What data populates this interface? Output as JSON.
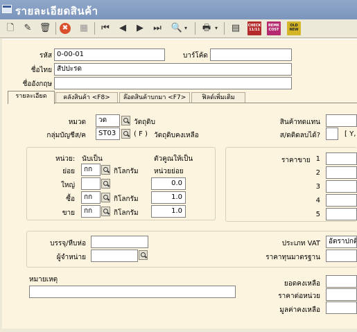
{
  "window": {
    "title": "รายละเอียดสินค้า"
  },
  "toolbar": {
    "buttons": [
      {
        "name": "new-icon",
        "glyph": "🗋"
      },
      {
        "name": "edit-icon",
        "glyph": "✎"
      },
      {
        "name": "delete-icon",
        "glyph": "🗑"
      },
      {
        "name": "cancel-icon",
        "glyph": "✖"
      },
      {
        "name": "save-icon",
        "glyph": "▦"
      },
      {
        "name": "first-record-icon",
        "glyph": "⏮"
      },
      {
        "name": "previous-record-icon",
        "glyph": "◀"
      },
      {
        "name": "next-record-icon",
        "glyph": "▶"
      },
      {
        "name": "last-record-icon",
        "glyph": "⏭"
      },
      {
        "name": "search-icon",
        "glyph": "🔍"
      },
      {
        "name": "print-icon",
        "glyph": "🖶"
      },
      {
        "name": "calculator-icon",
        "glyph": "▤"
      }
    ],
    "badges": [
      "CHECK 11/11",
      "REMK COST",
      "OLD NEW"
    ]
  },
  "header": {
    "code_label": "รหัส",
    "code_value": "0-00-01",
    "barcode_label": "บาร์โค้ด",
    "barcode_value": "",
    "thai_name_label": "ชื่อไทย",
    "thai_name_value": "สัปปะรด",
    "eng_name_label": "ชื่ออังกฤษ",
    "eng_name_value": ""
  },
  "tabs": [
    "รายละเอียด",
    "คลังสินค้า <F8>",
    "ล๊อตสินค้าบกมา <F7>",
    "ฟิลด์เพิ่มเติม"
  ],
  "details": {
    "category_label": "หมวด",
    "category_code": "วด",
    "category_name": "วัตถุดิบ",
    "account_group_label": "กลุ่มบัญชีส/ค",
    "account_group_code": "ST03",
    "account_group_type": "( F )",
    "account_group_name": "วัตถุดิบคงเหลือ",
    "substitute_label": "สินค้าทดแทน",
    "substitute_value": "",
    "negative_stock_label": "ส/ดติดลบได้?",
    "negative_stock_hint": "[ Y,",
    "unit_heading": "หน่วย:",
    "unit_count_heading": "นับเป็น",
    "multiplier_heading": "ตัวคูณให้เป็น",
    "multiplier_sub": "หน่วยย่อย",
    "units": [
      {
        "label": "ย่อย",
        "code": "กก",
        "name": "กิโลกรัม",
        "factor": ""
      },
      {
        "label": "ใหญ่",
        "code": "",
        "name": "",
        "factor": "0.0"
      },
      {
        "label": "ซื้อ",
        "code": "กก",
        "name": "กิโลกรัม",
        "factor": "1.0"
      },
      {
        "label": "ขาย",
        "code": "กก",
        "name": "กิโลกรัม",
        "factor": "1.0"
      }
    ],
    "price_label": "ราคาขาย",
    "price_levels": [
      "1",
      "2",
      "3",
      "4",
      "5"
    ],
    "package_label": "บรรจุ/หีบห่อ",
    "package_value": "",
    "vendor_label": "ผู้จำหน่าย",
    "vendor_value": "",
    "vat_label": "ประเภท VAT",
    "vat_value": "อัตราปกติ",
    "std_cost_label": "ราคาทุนมาตรฐาน",
    "std_cost_value": "",
    "remark_label": "หมายเหตุ",
    "remark_value": "",
    "balance_label": "ยอดคงเหลือ",
    "balance_value": "",
    "unit_price_label": "ราคาต่อหน่วย",
    "unit_price_value": "",
    "balance_amount_label": "มูลค่าคงเหลือ",
    "balance_amount_value": ""
  },
  "colors": {
    "title_bar": "#7c95bc",
    "panel": "#fdf4df",
    "chrome": "#ece9d8"
  }
}
